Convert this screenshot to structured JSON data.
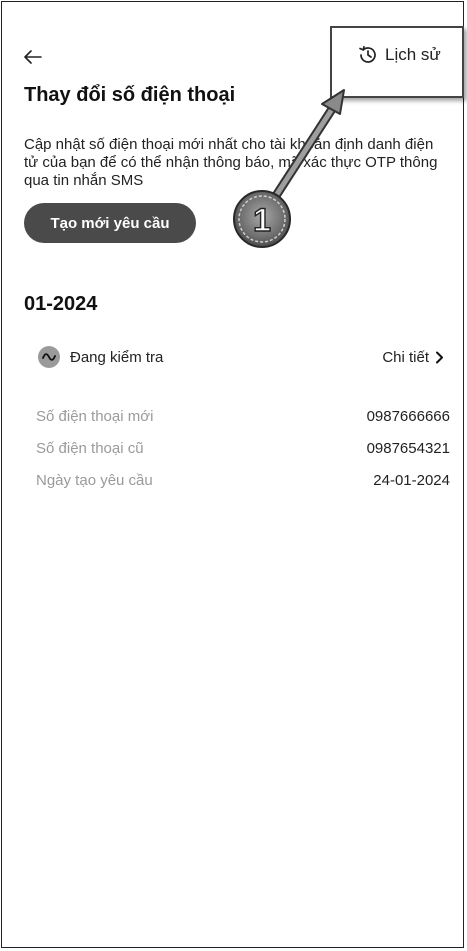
{
  "header": {
    "back_icon": "arrow-left-icon",
    "history_label": "Lịch sử",
    "history_icon": "history-clock-icon"
  },
  "page": {
    "title": "Thay đổi số điện thoại",
    "description": "Cập nhật số điện thoại mới nhất cho tài khoản định danh điện tử của bạn để có thể nhận thông báo, mã xác thực OTP thông qua tin nhắn SMS",
    "create_button": "Tạo mới yêu cầu"
  },
  "request": {
    "period": "01-2024",
    "status": "Đang kiểm tra",
    "status_icon": "pending-wave-icon",
    "detail_label": "Chi tiết",
    "detail_icon": "chevron-right-icon",
    "fields": [
      {
        "label": "Số điện thoại mới",
        "value": "0987666666"
      },
      {
        "label": "Số điện thoại cũ",
        "value": "0987654321"
      },
      {
        "label": "Ngày tạo yêu cầu",
        "value": "24-01-2024"
      }
    ]
  },
  "annotation": {
    "step_number": "1"
  },
  "colors": {
    "primary_button": "#4a4a4a",
    "muted_text": "#9a9a9a",
    "text": "#222222"
  }
}
